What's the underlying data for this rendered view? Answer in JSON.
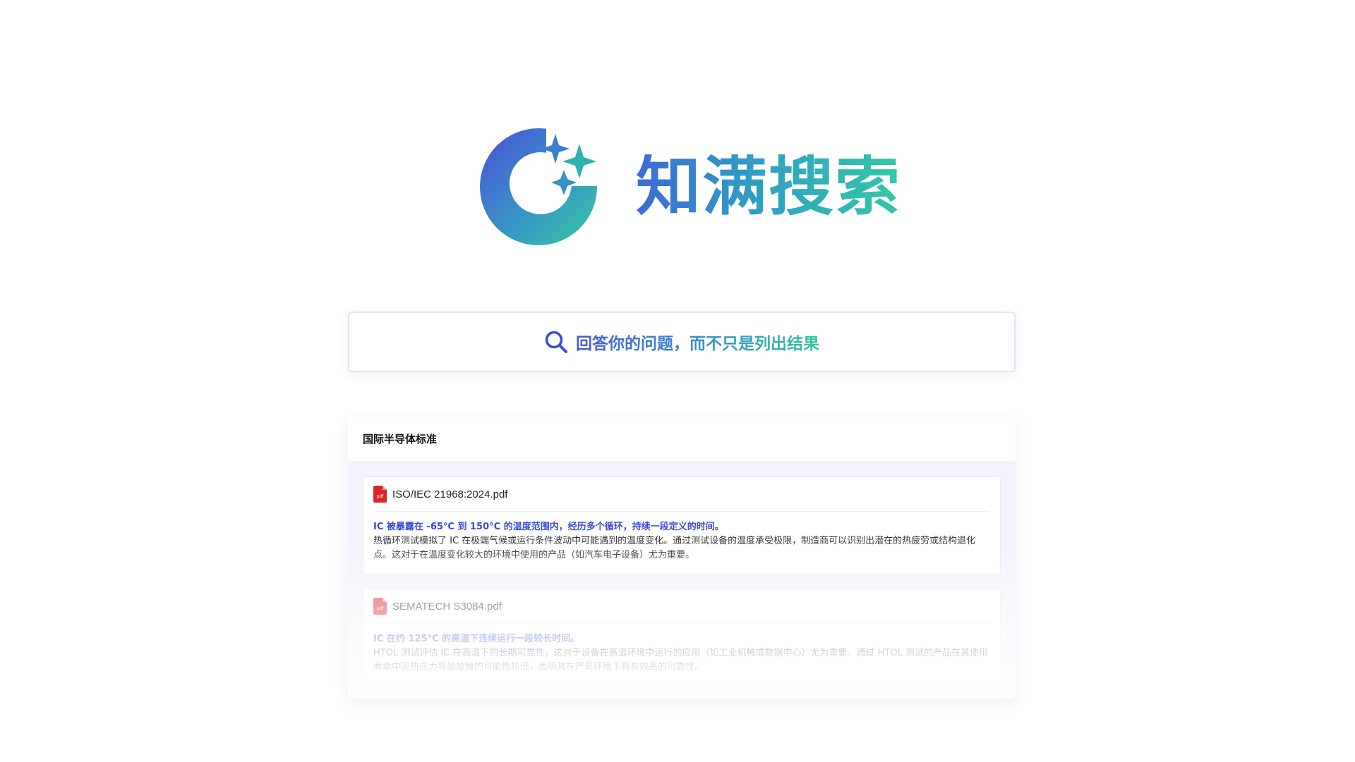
{
  "brand": {
    "name": "知满搜索",
    "logo_icon": "crescent-sparkle-logo",
    "gradient_start": "#3d6ad6",
    "gradient_end": "#34c7a6"
  },
  "search": {
    "icon": "search-icon",
    "slogan": "回答你的问题，而不只是列出结果",
    "icon_color": "#3a4bd8"
  },
  "results": {
    "category": "国际半导体标准",
    "items": [
      {
        "file_icon": "pdf-icon",
        "file_badge": "pdf",
        "file_name": "ISO/IEC 21968:2024.pdf",
        "summary": "IC 被暴露在 -65°C 到 150°C 的温度范围内，经历多个循环，持续一段定义的时间。",
        "detail": "热循环测试模拟了 IC 在极端气候或运行条件波动中可能遇到的温度变化。通过测试设备的温度承受极限，制造商可以识别出潜在的热疲劳或结构退化点。这对于在温度变化较大的环境中使用的产品（如汽车电子设备）尤为重要。"
      },
      {
        "file_icon": "pdf-icon",
        "file_badge": "pdf",
        "file_name": "SEMATECH S3084.pdf",
        "summary": "IC 在约 125°C 的高温下连续运行一段较长时间。",
        "detail": "HTOL 测试评估 IC 在高温下的长期可靠性，这对于设备在高温环境中运行的应用（如工业机械或数据中心）尤为重要。通过 HTOL 测试的产品在其使用寿命中因热应力导致故障的可能性较低，表明其在严苛环境下具有较高的可靠性。"
      }
    ]
  }
}
